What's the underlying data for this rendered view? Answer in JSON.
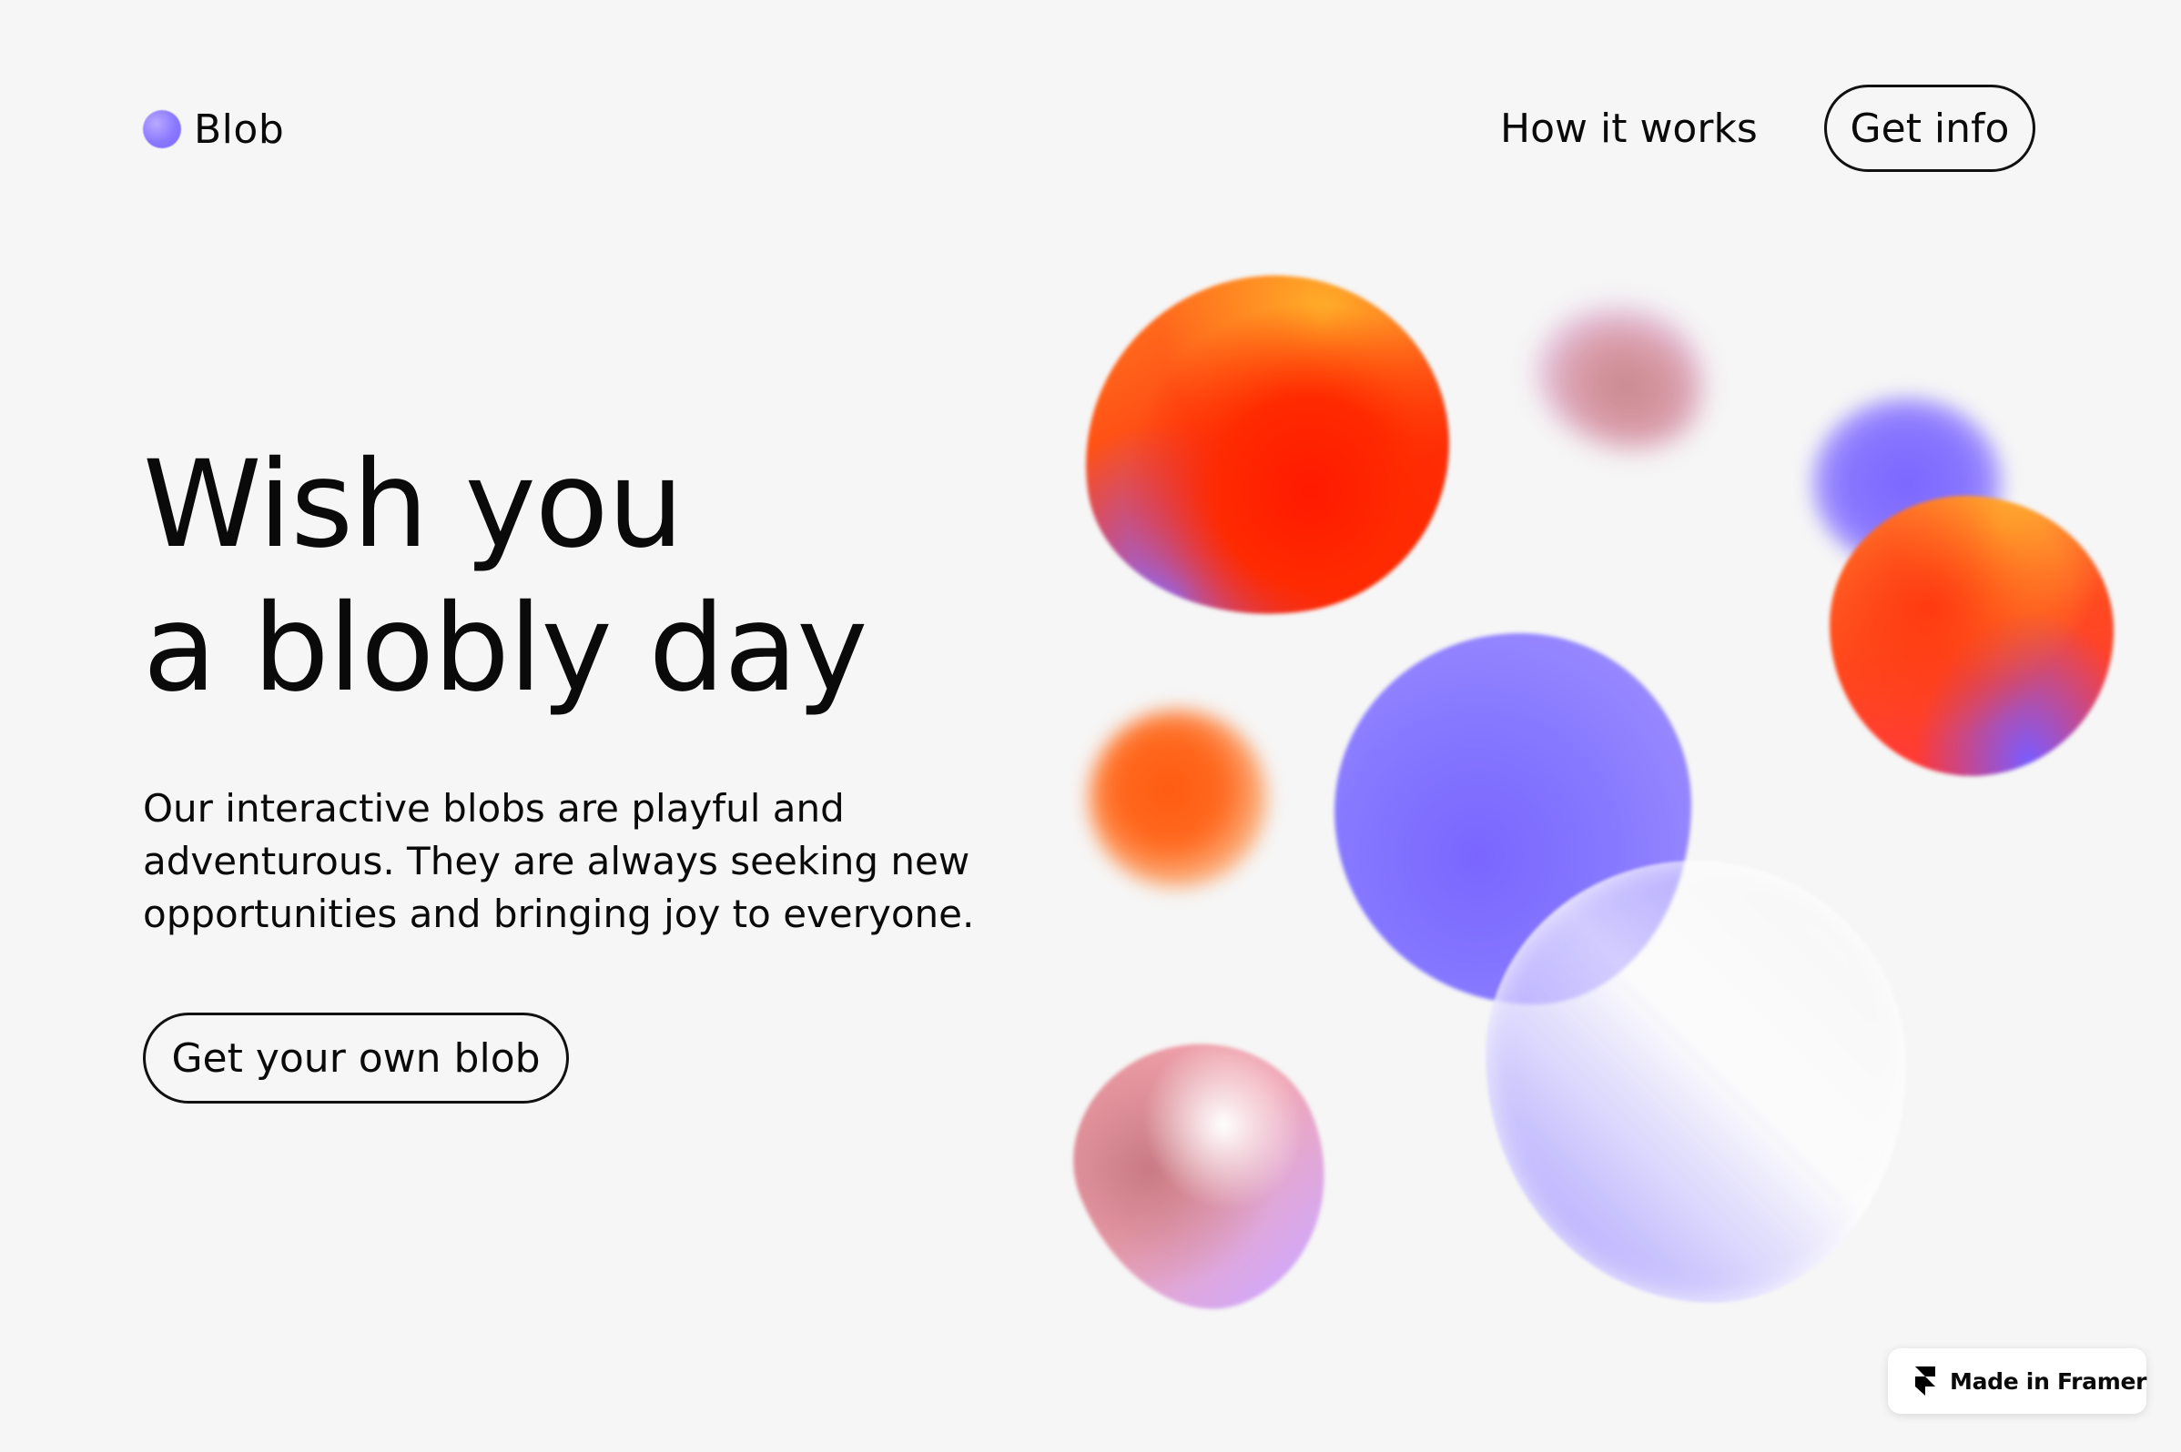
{
  "header": {
    "brand": "Blob",
    "nav_link": "How it works",
    "nav_button": "Get info"
  },
  "hero": {
    "title_line_1": "Wish you",
    "title_line_2": "a blobly day",
    "text_line_1": "Our interactive blobs are playful and",
    "text_line_2": "adventurous. They are always seeking new",
    "text_line_3": "opportunities and bringing joy to everyone.",
    "cta": "Get your own blob"
  },
  "badge": {
    "label": "Made in Framer",
    "icon": "framer-icon"
  },
  "colors": {
    "background": "#f6f6f6",
    "text": "#0a0a0a",
    "blob_blue": "#7b66ff",
    "blob_red": "#ff2a00",
    "blob_orange": "#ff6a20",
    "blob_pink": "#f0a6b4"
  }
}
